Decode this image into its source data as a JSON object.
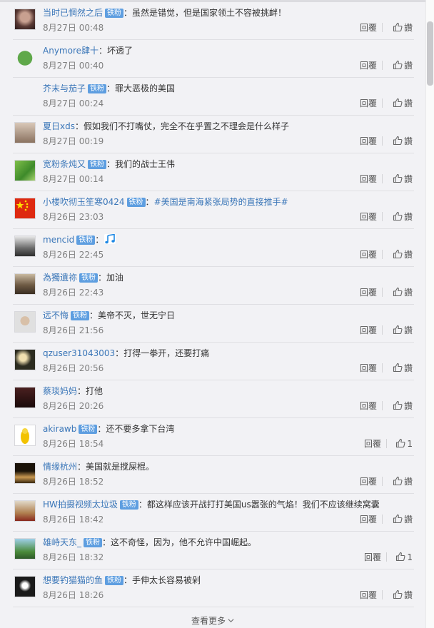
{
  "labels": {
    "reply": "回覆",
    "like": "讚",
    "badge": "铁粉"
  },
  "comments": [
    {
      "user": "当时已惘然之后",
      "badge": true,
      "text": "虽然是错觉，但是国家领土不容被挑衅！",
      "time": "8月27日 00:48",
      "likes": ""
    },
    {
      "user": "Anymore肆十",
      "badge": false,
      "text": "坏透了",
      "time": "8月27日 00:40",
      "likes": ""
    },
    {
      "user": "芥末与茄子",
      "badge": true,
      "text": "罪大恶极的美国",
      "time": "8月27日 00:24",
      "likes": ""
    },
    {
      "user": "夏日xds",
      "badge": false,
      "text": "假如我们不打嘴仗，完全不在乎置之不理会是什么样子",
      "time": "8月27日 00:19",
      "likes": ""
    },
    {
      "user": "宽粉条炖又",
      "badge": true,
      "text": "我们的战士王伟",
      "time": "8月27日 00:14",
      "likes": ""
    },
    {
      "user": "小楼吹彻玉笙寒0424",
      "badge": true,
      "text": "#美国是南海紧张局势的直接推手#",
      "time": "8月26日 23:03",
      "likes": "",
      "topic": true
    },
    {
      "user": "mencid",
      "badge": true,
      "text": "",
      "time": "8月26日 22:45",
      "likes": "",
      "emoji": "music-note-icon"
    },
    {
      "user": "為獨遺祢",
      "badge": true,
      "text": "加油",
      "time": "8月26日 22:43",
      "likes": ""
    },
    {
      "user": "远不悔",
      "badge": true,
      "text": "美帝不灭，世无宁日",
      "time": "8月26日 21:56",
      "likes": ""
    },
    {
      "user": "qzuser31043003",
      "badge": false,
      "text": "打得一拳开，还要打痛",
      "time": "8月26日 20:56",
      "likes": ""
    },
    {
      "user": "蔡琰妈妈",
      "badge": false,
      "text": "打他",
      "time": "8月26日 20:26",
      "likes": ""
    },
    {
      "user": "akirawb",
      "badge": true,
      "text": "还不要多拿下台湾",
      "time": "8月26日 18:54",
      "likes": "1"
    },
    {
      "user": "情缘杭州",
      "badge": false,
      "text": "美国就是搅屎棍。",
      "time": "8月26日 18:52",
      "likes": ""
    },
    {
      "user": "HW拍摄视频太垃圾",
      "badge": true,
      "text": "都这样应该开战打打美国us嚣张的气焰！我们不应该继续窝囊",
      "time": "8月26日 18:42",
      "likes": ""
    },
    {
      "user": "雄峙天东_",
      "badge": true,
      "text": "这不奇怪，因为，他不允许中国崛起。",
      "time": "8月26日 18:32",
      "likes": "1"
    },
    {
      "user": "想要钓猫猫的鱼",
      "badge": true,
      "text": "手伸太长容易被剁",
      "time": "8月26日 18:26",
      "likes": ""
    }
  ],
  "more_label": "查看更多",
  "colors": {
    "link": "#3a76b8",
    "badge": "#5e9ee0",
    "time": "#808080"
  }
}
